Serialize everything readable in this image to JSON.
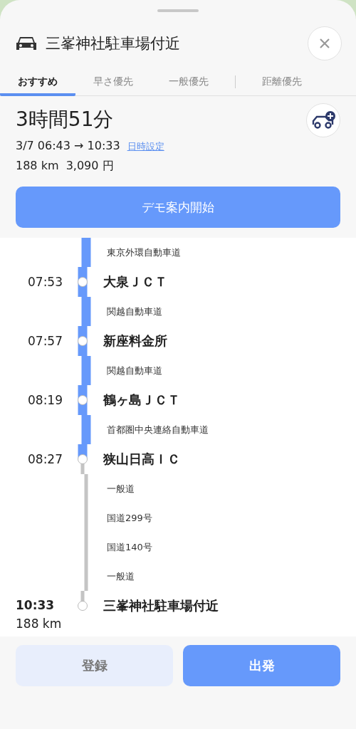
{
  "header": {
    "title": "三峯神社駐車場付近"
  },
  "tabs": [
    {
      "label": "おすすめ",
      "selected": true
    },
    {
      "label": "早さ優先",
      "selected": false
    },
    {
      "label": "一般優先",
      "selected": false
    },
    {
      "label": "距離優先",
      "selected": false
    }
  ],
  "summary": {
    "duration": "3時間51分",
    "times": "3/7 06:43 → 10:33",
    "date_link": "日時設定",
    "distance_fare": "188 km  3,090 円"
  },
  "demo_button": "デモ案内開始",
  "route": [
    {
      "kind": "road",
      "name": "東京外環自動車道",
      "toll": true
    },
    {
      "kind": "point",
      "time": "07:53",
      "name": "大泉ＪＣＴ"
    },
    {
      "kind": "road",
      "name": "関越自動車道",
      "toll": true
    },
    {
      "kind": "point",
      "time": "07:57",
      "name": "新座料金所"
    },
    {
      "kind": "road",
      "name": "関越自動車道",
      "toll": true
    },
    {
      "kind": "point",
      "time": "08:19",
      "name": "鶴ヶ島ＪＣＴ"
    },
    {
      "kind": "road",
      "name": "首都圏中央連絡自動車道",
      "toll": true
    },
    {
      "kind": "point",
      "time": "08:27",
      "name": "狭山日高ＩＣ"
    },
    {
      "kind": "road",
      "name": "一般道",
      "toll": false
    },
    {
      "kind": "road",
      "name": "国道299号",
      "toll": false
    },
    {
      "kind": "road",
      "name": "国道140号",
      "toll": false
    },
    {
      "kind": "road",
      "name": "一般道",
      "toll": false
    },
    {
      "kind": "destination",
      "time": "10:33",
      "name": "三峯神社駐車場付近",
      "distance": "188 km"
    }
  ],
  "footer": {
    "register_button": "登録",
    "start_button": "出発"
  }
}
